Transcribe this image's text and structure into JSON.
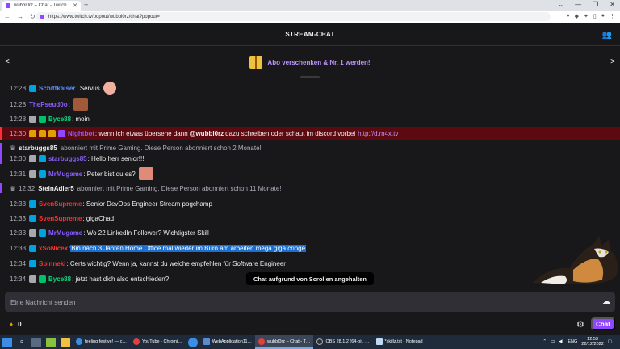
{
  "browser": {
    "tab_title": "wubbl0rz – Chat - Twitch",
    "url": "https://www.twitch.tv/popout/wubbl0rz/chat?popout="
  },
  "header": {
    "title": "STREAM-CHAT"
  },
  "gift_banner": {
    "text": "Abo verschenken & Nr. 1 werden!"
  },
  "messages": [
    {
      "time": "12:28",
      "user": "Schiffkaiser",
      "color": "#5b8dff",
      "text": ": Servus"
    },
    {
      "time": "12:28",
      "user": "ThePseud0o",
      "color": "#8a5cff",
      "text": ":"
    },
    {
      "time": "12:28",
      "user": "Byce88",
      "color": "#00e07a",
      "text": ": moin"
    },
    {
      "time": "12:30",
      "user": "Nightbot",
      "color": "#8a5cff",
      "text": ": wenn ich etwas übersehe dann",
      "mention": "@wubbl0rz",
      "text2": "dazu schreiben oder schaut im discord vorbei",
      "link": "http://d.m4x.tv"
    },
    {
      "sub_user": "starbuggs85",
      "sub_text": "abonniert mit Prime Gaming. Diese Person abonniert schon 2 Monate!"
    },
    {
      "time": "12:30",
      "user": "starbuggs85",
      "color": "#8a5cff",
      "text": ": Hello herr senior!!!"
    },
    {
      "time": "12:31",
      "user": "MrMugame",
      "color": "#8a5cff",
      "text": ": Peter bist du es?"
    },
    {
      "time": "12:32",
      "sub_user": "SteinAdler5",
      "sub_text": "abonniert mit Prime Gaming. Diese Person abonniert schon 11 Monate!"
    },
    {
      "time": "12:33",
      "user": "SvenSupreme",
      "color": "#ff3030",
      "text": ": Senior DevOps Engineer Stream pogchamp"
    },
    {
      "time": "12:33",
      "user": "SvenSupreme",
      "color": "#ff3030",
      "text": ": gigaChad"
    },
    {
      "time": "12:33",
      "user": "MrMugame",
      "color": "#8a5cff",
      "text": ": Wo 22 LinkedIn Follower? Wichtigster Skill"
    },
    {
      "time": "12:33",
      "user": "xSoNicex",
      "color": "#ff3030",
      "text": ":",
      "selected": "Bin nach 3 Jahren Home Office mal wieder im Büro am arbeiten mega giga cringe"
    },
    {
      "time": "12:34",
      "user": "Spinneki",
      "color": "#ff3030",
      "text": ": Certs wichtig? Wenn ja, kannst du welche empfehlen für Software Engineer"
    },
    {
      "time": "12:34",
      "user": "Byce88",
      "color": "#00e07a",
      "text": ": jetzt hast dich also entschieden?"
    }
  ],
  "paused_notice": "Chat aufgrund von Scrollen angehalten",
  "input": {
    "placeholder": "Eine Nachricht senden"
  },
  "points": "0",
  "chat_button": "Chat",
  "taskbar": {
    "apps": [
      "feeling festive! — c…",
      "YouTube - Chromi…",
      "WebApplication11…",
      "wubbl0rz – Chat - T…",
      "OBS 28.1.2 (64-bit, …",
      "*skillz.txt - Notepad"
    ],
    "lang": "ENG",
    "time": "12:53",
    "date": "22/12/2022"
  }
}
